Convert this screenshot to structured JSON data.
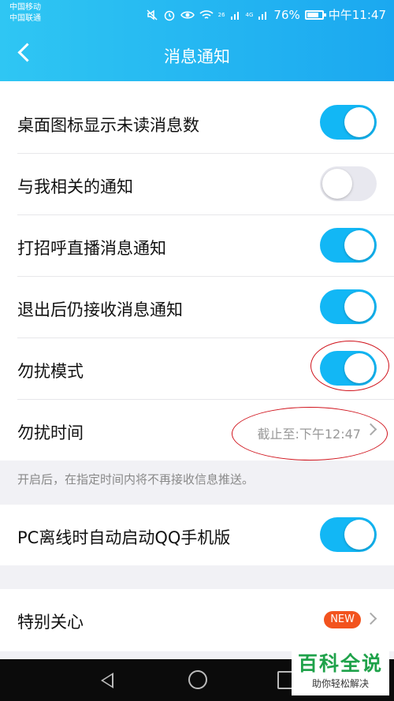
{
  "status_bar": {
    "carrier_1": "中国移动",
    "carrier_2": "中国联通",
    "net_1": "26",
    "net_2": "4G",
    "battery": "76%",
    "battery_level": 0.76,
    "time": "中午11:47"
  },
  "header": {
    "title": "消息通知"
  },
  "settings": {
    "rows": [
      {
        "label": "桌面图标显示未读消息数",
        "on": true
      },
      {
        "label": "与我相关的通知",
        "on": false
      },
      {
        "label": "打招呼直播消息通知",
        "on": true
      },
      {
        "label": "退出后仍接收消息通知",
        "on": true
      },
      {
        "label": "勿扰模式",
        "on": true
      },
      {
        "label": "勿扰时间",
        "value": "截止至:下午12:47"
      }
    ],
    "note": "开启后，在指定时间内将不再接收信息推送。",
    "pc_row": {
      "label": "PC离线时自动启动QQ手机版",
      "on": true
    },
    "special_row": {
      "label": "特别关心",
      "badge": "NEW"
    }
  },
  "watermark": {
    "main": "百科全说",
    "sub": "助你轻松解决"
  },
  "colors": {
    "accent": "#12b7f5",
    "annotation": "#d0131c",
    "badge": "#f2531e"
  }
}
